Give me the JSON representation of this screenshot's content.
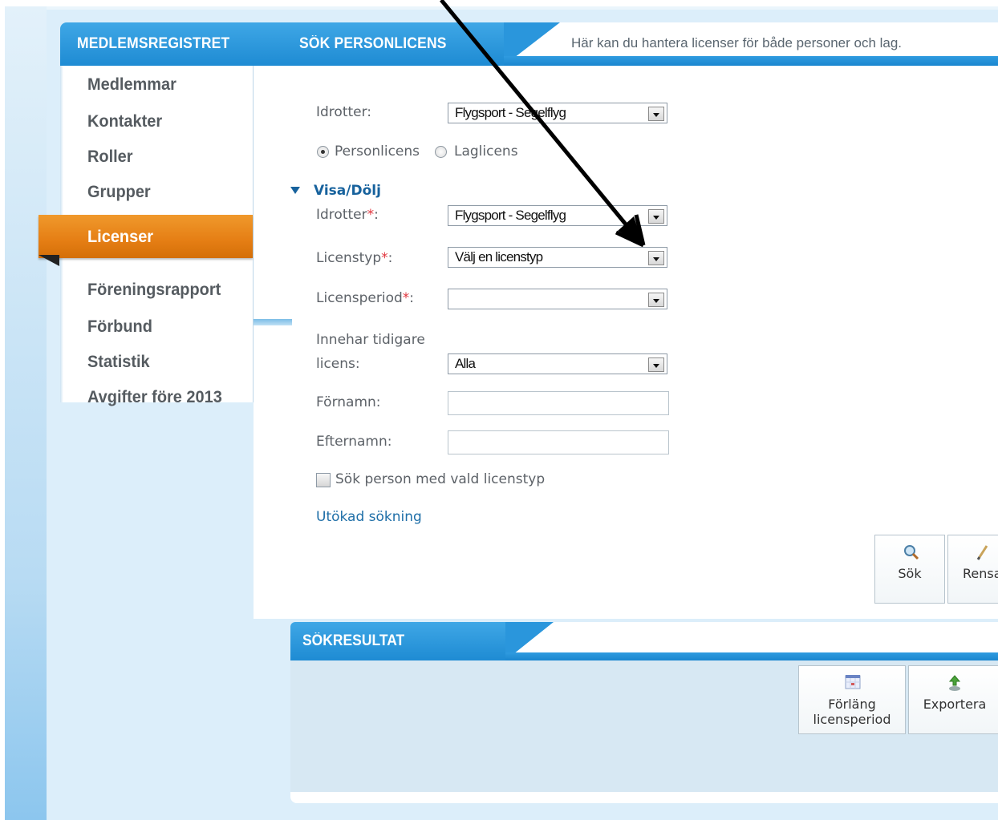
{
  "header": {
    "section_title": "MEDLEMSREGISTRET",
    "page_title": "SÖK PERSONLICENS",
    "description": "Här kan du hantera licenser för både personer och lag."
  },
  "sidebar": {
    "items": [
      {
        "label": "Medlemmar"
      },
      {
        "label": "Kontakter"
      },
      {
        "label": "Roller"
      },
      {
        "label": "Grupper"
      },
      {
        "label": "Licenser",
        "active": true
      },
      {
        "label": "Föreningsrapport"
      },
      {
        "label": "Förbund"
      },
      {
        "label": "Statistik"
      },
      {
        "label": "Avgifter före 2013"
      }
    ]
  },
  "form": {
    "sport_label": "Idrotter:",
    "sport_value": "Flygsport - Segelflyg",
    "license_kind": {
      "options": [
        "Personlicens",
        "Laglicens"
      ],
      "selected": "Personlicens"
    },
    "toggle_label": "Visa/Dölj",
    "sport2_label": "Idrotter",
    "sport2_value": "Flygsport - Segelflyg",
    "license_type_label": "Licenstyp",
    "license_type_value": "Välj en licenstyp",
    "license_period_label": "Licensperiod",
    "license_period_value": "",
    "prior_license_label_line1": "Innehar tidigare",
    "prior_license_label_line2": "licens:",
    "prior_license_value": "Alla",
    "firstname_label": "Förnamn:",
    "firstname_value": "",
    "lastname_label": "Efternamn:",
    "lastname_value": "",
    "required_mark": "*",
    "colon": ":",
    "checkbox_label": "Sök person med vald licenstyp",
    "checkbox_checked": false,
    "advanced_link": "Utökad sökning"
  },
  "actions": {
    "search_label": "Sök",
    "clear_label": "Rensa"
  },
  "results": {
    "title": "SÖKRESULTAT",
    "extend_label_line1": "Förläng",
    "extend_label_line2": "licensperiod",
    "export_label": "Exportera"
  },
  "colors": {
    "header_blue": "#1e8bd3",
    "active_orange": "#e57e14",
    "link_blue": "#1f6fa8",
    "required_red": "#e0343c"
  },
  "icons": {
    "toggle": "triangle-down-icon",
    "search": "magnifier-icon",
    "clear": "eraser-icon",
    "extend": "calendar-icon",
    "export": "export-arrow-icon",
    "select": "dropdown-arrow-icon"
  }
}
